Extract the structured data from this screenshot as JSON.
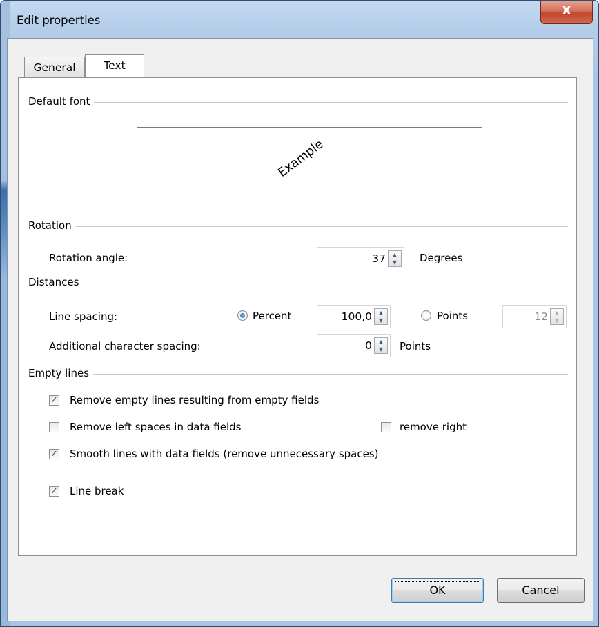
{
  "window": {
    "title": "Edit properties",
    "close_label": "X"
  },
  "tabs": [
    {
      "label": "General",
      "active": false
    },
    {
      "label": "Text",
      "active": true
    }
  ],
  "default_font": {
    "group_label": "Default font",
    "preview_text": "Example",
    "preview_rotation_degrees": 37
  },
  "rotation": {
    "group_label": "Rotation",
    "angle_label": "Rotation angle:",
    "angle_value": "37",
    "unit_label": "Degrees"
  },
  "distances": {
    "group_label": "Distances",
    "line_spacing_label": "Line spacing:",
    "percent_option": "Percent",
    "percent_selected": true,
    "percent_value": "100,0",
    "points_option": "Points",
    "points_selected": false,
    "points_value": "12",
    "char_spacing_label": "Additional character spacing:",
    "char_spacing_value": "0",
    "char_spacing_unit": "Points"
  },
  "empty_lines": {
    "group_label": "Empty lines",
    "remove_empty_lines": {
      "label": "Remove empty lines resulting from empty fields",
      "checked": true
    },
    "remove_left_spaces": {
      "label": "Remove left spaces in data fields",
      "checked": false
    },
    "remove_right": {
      "label": "remove right",
      "checked": false
    },
    "smooth_lines": {
      "label": "Smooth lines with data fields (remove unnecessary spaces)",
      "checked": true
    },
    "line_break": {
      "label": "Line break",
      "checked": true
    }
  },
  "buttons": {
    "ok": "OK",
    "cancel": "Cancel"
  },
  "icons": {
    "check": "✓",
    "spin_up": "▲",
    "spin_down": "▼"
  }
}
